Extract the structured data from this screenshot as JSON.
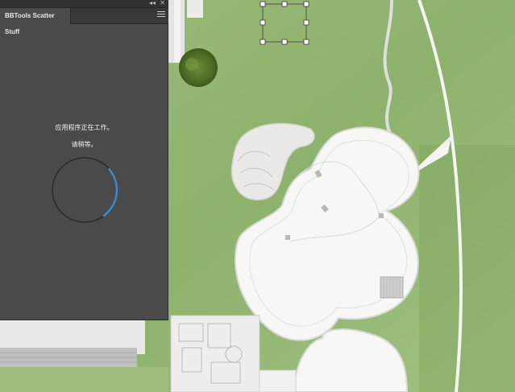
{
  "panel": {
    "tab_title": "BBTools Scatter Stuff",
    "collapse_icon": "◂◂",
    "close_icon": "✕",
    "menu_icon": "hamburger-menu-icon",
    "status_line1": "应用程序正在工作。",
    "status_line2": "请稍等。",
    "spinner_color": "#2f8fd8",
    "spinner_track_color": "#2b2b2b"
  },
  "canvas": {
    "lawn_color": "#8fb36e",
    "plaza_color": "#f7f7f5",
    "path_color": "#dcdcdc"
  }
}
